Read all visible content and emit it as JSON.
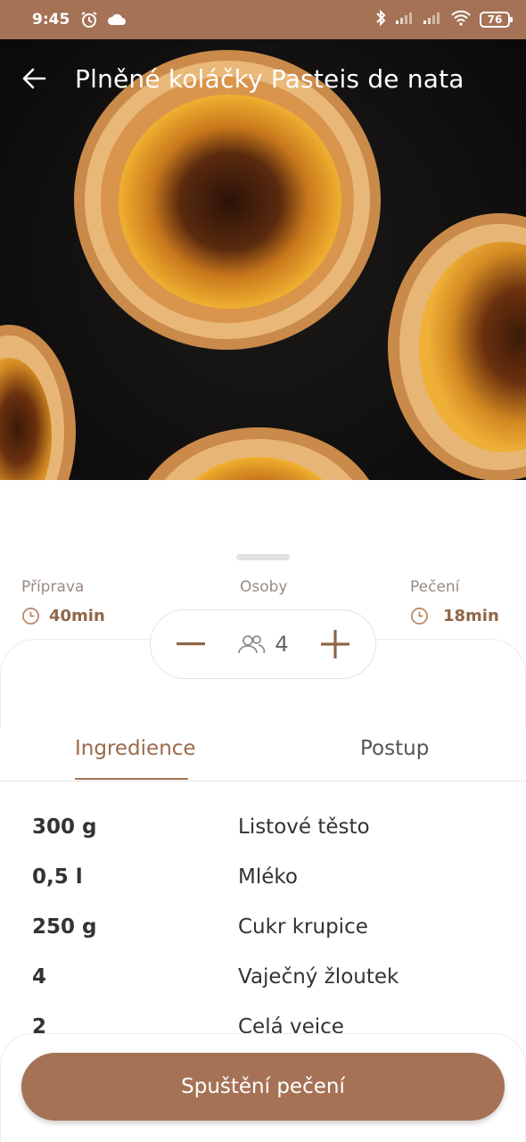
{
  "status_bar": {
    "time": "9:45",
    "battery": "76"
  },
  "header": {
    "title": "Plněné koláčky Pasteis de nata"
  },
  "info": {
    "prep_label": "Příprava",
    "prep_value": "40min",
    "people_label": "Osoby",
    "bake_label": "Pečení",
    "bake_value": "18min"
  },
  "stepper": {
    "count": "4"
  },
  "tabs": [
    {
      "label": "Ingredience",
      "active": true
    },
    {
      "label": "Postup",
      "active": false
    }
  ],
  "ingredients": [
    {
      "amount": "300 g",
      "name": "Listové těsto"
    },
    {
      "amount": "0,5 l",
      "name": "Mléko"
    },
    {
      "amount": "250 g",
      "name": "Cukr krupice"
    },
    {
      "amount": "4",
      "name": "Vaječný žloutek"
    },
    {
      "amount": "2",
      "name": "Celá vejce"
    }
  ],
  "action": {
    "start_label": "Spuštění pečení"
  },
  "colors": {
    "accent": "#a57256",
    "accent_text": "#9c6a4a"
  }
}
